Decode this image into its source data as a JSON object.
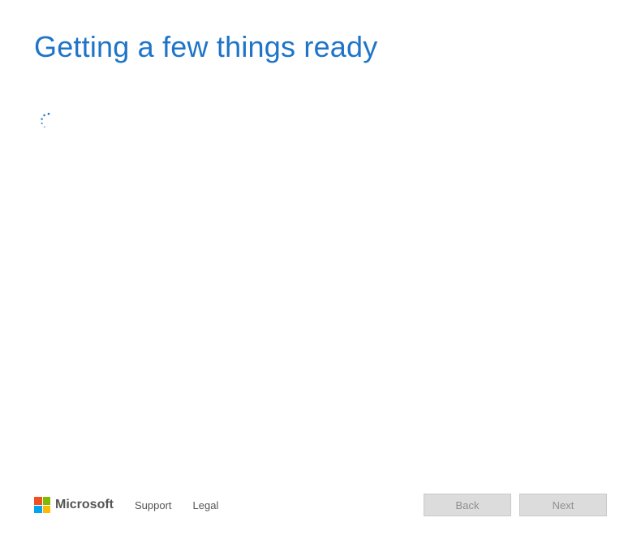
{
  "header": {
    "title": "Getting a few things ready"
  },
  "footer": {
    "brand": "Microsoft",
    "links": {
      "support": "Support",
      "legal": "Legal"
    },
    "buttons": {
      "back": "Back",
      "next": "Next"
    }
  },
  "colors": {
    "accent": "#1e74c8"
  }
}
